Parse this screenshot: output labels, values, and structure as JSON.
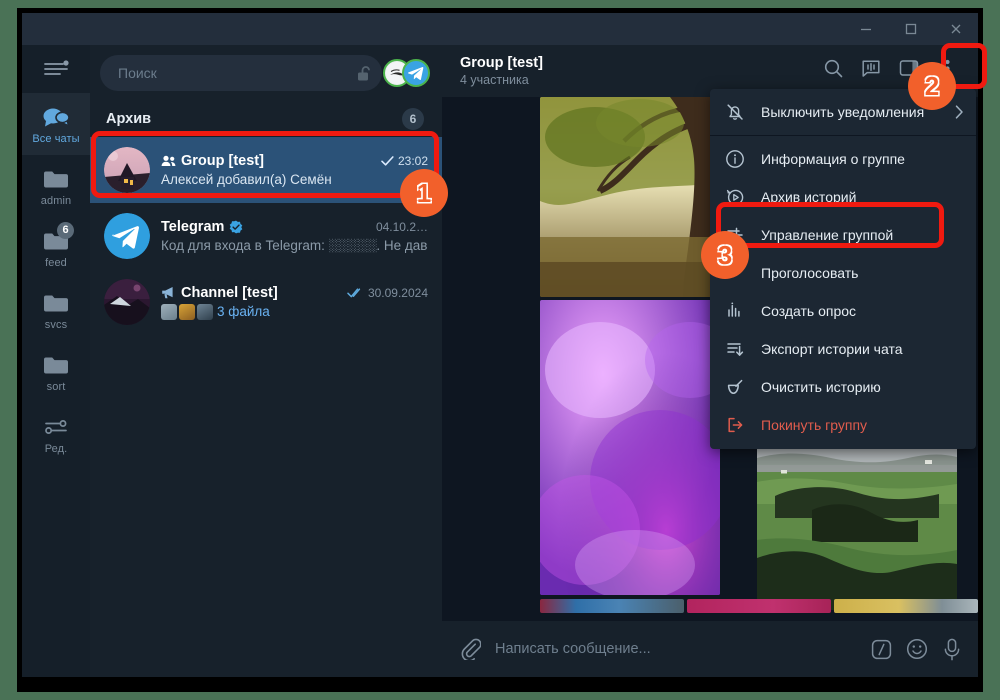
{
  "window": {
    "controls": [
      {
        "name": "minimize",
        "glyph": "minimize-icon"
      },
      {
        "name": "maximize",
        "glyph": "maximize-icon"
      },
      {
        "name": "close",
        "glyph": "close-icon"
      }
    ]
  },
  "rail": {
    "menu_icon": "hamburger-menu-icon",
    "items": [
      {
        "label": "Все чаты",
        "icon": "chats-bubble-icon",
        "badge": "",
        "active": true
      },
      {
        "label": "admin",
        "icon": "folder-icon",
        "badge": "",
        "active": false
      },
      {
        "label": "feed",
        "icon": "folder-icon",
        "badge": "6",
        "active": false
      },
      {
        "label": "svcs",
        "icon": "folder-icon",
        "badge": "",
        "active": false
      },
      {
        "label": "sort",
        "icon": "folder-icon",
        "badge": "",
        "active": false
      },
      {
        "label": "Ред.",
        "icon": "sliders-edit-icon",
        "badge": "",
        "active": false
      }
    ]
  },
  "search": {
    "placeholder": "Поиск",
    "lock_icon": "unlocked-padlock-icon",
    "avatar_primary": "telegram-logo-avatar",
    "avatar_secondary": "second-account-avatar"
  },
  "chatlist": {
    "archive_label": "Архив",
    "archive_count": "6",
    "items": [
      {
        "name": "Group [test]",
        "preview": "Алексей добавил(а) Семён",
        "time": "23:02",
        "status_icon": "single-check-icon",
        "prefix_icon": "group-people-icon",
        "verified": false,
        "selected": true,
        "avatar": "house-illustration-avatar"
      },
      {
        "name": "Telegram",
        "preview": "Код для входа в Telegram: ░░░░░. Не давайт…",
        "time": "04.10.2…",
        "status_icon": "",
        "prefix_icon": "",
        "verified": true,
        "selected": false,
        "avatar": "telegram-logo-avatar"
      },
      {
        "name": "Channel [test]",
        "preview": "3 файла",
        "time": "30.09.2024",
        "status_icon": "double-check-icon",
        "prefix_icon": "megaphone-icon",
        "verified": false,
        "selected": false,
        "avatar": "dark-landscape-avatar",
        "thumbs": [
          "#8a9aa6",
          "#c9922f",
          "#5f7588"
        ]
      }
    ]
  },
  "chat_header": {
    "title": "Group [test]",
    "subtitle": "4 участника",
    "actions": [
      {
        "name": "search-icon",
        "label": "Поиск"
      },
      {
        "name": "story-stats-icon",
        "label": "Истории"
      },
      {
        "name": "sidebar-panel-icon",
        "label": "Панель"
      },
      {
        "name": "more-vertical-icon",
        "label": "Ещё"
      }
    ]
  },
  "menu": {
    "items": [
      {
        "label": "Выключить уведомления",
        "icon": "muted-bell-icon",
        "submenu": true,
        "danger": false,
        "separator_after": true
      },
      {
        "label": "Информация о группе",
        "icon": "info-circle-icon",
        "submenu": false,
        "danger": false,
        "separator_after": false
      },
      {
        "label": "Архив историй",
        "icon": "story-archive-icon",
        "submenu": false,
        "danger": false,
        "separator_after": false
      },
      {
        "label": "Управление группой",
        "icon": "sliders-icon",
        "submenu": false,
        "danger": false,
        "separator_after": false
      },
      {
        "label": "Проголосовать",
        "icon": "",
        "submenu": false,
        "danger": false,
        "separator_after": false
      },
      {
        "label": "Создать опрос",
        "icon": "poll-bars-icon",
        "submenu": false,
        "danger": false,
        "separator_after": false
      },
      {
        "label": "Экспорт истории чата",
        "icon": "export-down-icon",
        "submenu": false,
        "danger": false,
        "separator_after": false
      },
      {
        "label": "Очистить историю",
        "icon": "broom-icon",
        "submenu": false,
        "danger": false,
        "separator_after": false
      },
      {
        "label": "Покинуть группу",
        "icon": "leave-arrow-icon",
        "submenu": false,
        "danger": true,
        "separator_after": false
      }
    ]
  },
  "composer": {
    "attach_icon": "paperclip-icon",
    "placeholder": "Написать сообщение...",
    "command_icon": "slash-command-icon",
    "emoji_icon": "smiley-icon",
    "voice_icon": "microphone-icon"
  },
  "annotations": [
    {
      "number": "1",
      "target": "chat-list-selected-item"
    },
    {
      "number": "2",
      "target": "chat-menu-button"
    },
    {
      "number": "3",
      "target": "menu-item-group-management"
    }
  ],
  "colors": {
    "accent": "#2b5278",
    "annotation_box": "#f01a10",
    "annotation_badge": "#f2602b",
    "panel": "#17212b",
    "chat_bg": "#0e1621",
    "menu_bg": "#1c2733",
    "danger": "#e05c4d",
    "window_frame": "#000000",
    "desktop": "#4a7256"
  }
}
